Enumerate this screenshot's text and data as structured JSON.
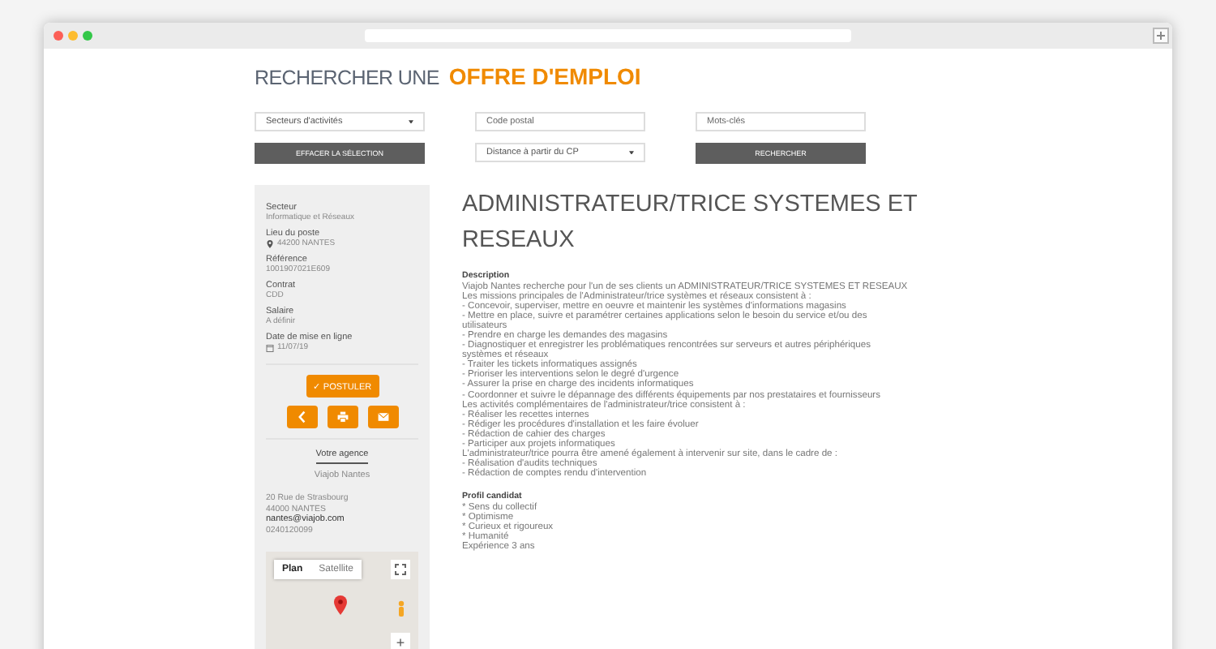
{
  "heading": {
    "prefix": "RECHERCHER UNE",
    "highlight": "OFFRE D'EMPLOI"
  },
  "filters": [
    {
      "kind": "select",
      "value": "Secteurs d'activités"
    },
    {
      "kind": "input",
      "placeholder": "Code postal"
    },
    {
      "kind": "input",
      "placeholder": "Mots-clés"
    },
    {
      "kind": "button",
      "label": "EFFACER LA SÉLECTION"
    },
    {
      "kind": "select",
      "value": "Distance à partir du CP"
    },
    {
      "kind": "button",
      "label": "RECHERCHER"
    }
  ],
  "details": [
    {
      "kind": "text",
      "label": "Secteur",
      "value": "Informatique et Réseaux"
    },
    {
      "kind": "place",
      "label": "Lieu du poste",
      "value": "44200 NANTES"
    },
    {
      "kind": "text",
      "label": "Référence",
      "value": "1001907021E609"
    },
    {
      "kind": "text",
      "label": "Contrat",
      "value": "CDD"
    },
    {
      "kind": "text",
      "label": "Salaire",
      "value": "A définir"
    },
    {
      "kind": "date",
      "label": "Date de mise en ligne",
      "value": "11/07/19"
    }
  ],
  "apply_button": "✓ POSTULER",
  "agency": {
    "heading": "Votre agence",
    "name": "Viajob Nantes",
    "address": [
      "20 Rue de Strasbourg",
      "44000 NANTES"
    ],
    "email": "nantes@viajob.com",
    "phone": "0240120099"
  },
  "map": {
    "tabs": [
      {
        "label": "Plan",
        "selected": true
      },
      {
        "label": "Satellite",
        "selected": false
      }
    ],
    "zoom_in": "+"
  },
  "job": {
    "title": "ADMINISTRATEUR/TRICE SYSTEMES ET RESEAUX",
    "description_heading": "Description",
    "description_lines": [
      "Viajob Nantes recherche pour l'un de ses clients un ADMINISTRATEUR/TRICE SYSTEMES ET RESEAUX",
      "Les missions principales de l'Administrateur/trice systèmes et réseaux consistent à :",
      "- Concevoir, superviser, mettre en oeuvre et maintenir les systèmes d'informations magasins",
      "- Mettre en place, suivre et paramétrer certaines applications selon le besoin du service et/ou des utilisateurs",
      "- Prendre en charge les demandes des magasins",
      "- Diagnostiquer et enregistrer les problématiques rencontrées sur serveurs et autres périphériques systèmes et réseaux",
      "- Traiter les tickets informatiques assignés",
      "- Prioriser les interventions selon le degré d'urgence",
      "- Assurer la prise en charge des incidents informatiques",
      "- Coordonner et suivre le dépannage des différents équipements par nos prestataires et fournisseurs",
      "Les activités complémentaires de l'administrateur/trice consistent à :",
      "- Réaliser les recettes internes",
      "- Rédiger les procédures d'installation et les faire évoluer",
      "- Rédaction de cahier des charges",
      "- Participer aux projets informatiques",
      "L'administrateur/trice pourra être amené également à intervenir sur site, dans le cadre de :",
      "- Réalisation d'audits techniques",
      "- Rédaction de comptes rendu d'intervention"
    ],
    "profile_heading": "Profil candidat",
    "profile_lines": [
      "* Sens du collectif",
      "* Optimisme",
      "* Curieux et rigoureux",
      "* Humanité",
      "Expérience 3 ans"
    ]
  }
}
